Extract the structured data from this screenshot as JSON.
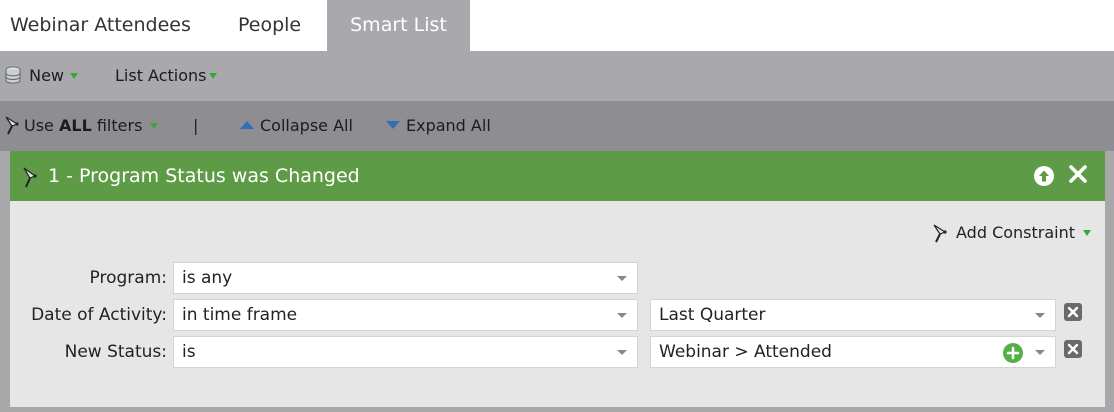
{
  "tabs": [
    {
      "label": "Webinar Attendees"
    },
    {
      "label": "People"
    },
    {
      "label": "Smart List"
    }
  ],
  "toolbar": {
    "new_label": "New",
    "list_actions_label": "List Actions"
  },
  "filter_bar": {
    "use_prefix": "Use ",
    "use_bold": "ALL",
    "use_suffix": " filters",
    "separator": "|",
    "collapse_label": "Collapse All",
    "expand_label": "Expand All"
  },
  "filter": {
    "title": "1 - Program Status was Changed",
    "add_constraint_label": "Add Constraint",
    "rows": [
      {
        "label": "Program:",
        "operator": "is any"
      },
      {
        "label": "Date of Activity:",
        "operator": "in time frame",
        "value": "Last Quarter"
      },
      {
        "label": "New Status:",
        "operator": "is",
        "value": "Webinar > Attended"
      }
    ]
  },
  "icons": {
    "new": "database-icon",
    "filter": "funnel-icon",
    "collapse": "triangle-up-icon",
    "expand": "triangle-down-icon",
    "move_up": "arrow-up-circle-icon",
    "close": "close-icon",
    "remove": "remove-icon",
    "add": "plus-circle-icon"
  },
  "colors": {
    "header_green": "#5e9b47",
    "caret_green": "#3aa63a",
    "active_tab": "#a9a9ad",
    "toolbar_dark": "#8e8e92",
    "link_blue": "#2e6fb8"
  }
}
